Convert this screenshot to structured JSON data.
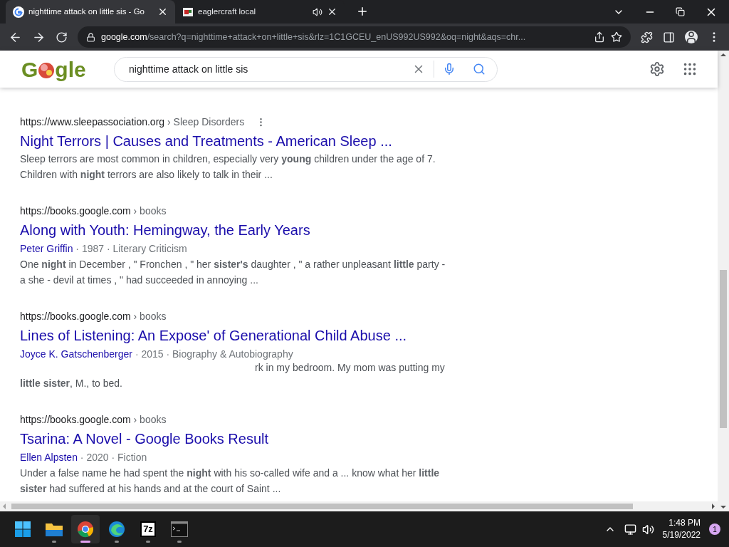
{
  "tabs": [
    {
      "title": "nighttime attack on little sis - Go",
      "selected": true,
      "kind": "google"
    },
    {
      "title": "eaglercraft local",
      "selected": false,
      "kind": "game",
      "audio": true
    }
  ],
  "address": {
    "host": "google.com",
    "path": "/search?q=nighttime+attack+on+little+sis&rlz=1C1GCEU_enUS992US992&oq=night&aqs=chr..."
  },
  "logo": {
    "left": "G",
    "right": "gle"
  },
  "search": {
    "value": "nighttime attack on little sis"
  },
  "results": [
    {
      "url": "https://www.sleepassociation.org",
      "crumb": "› Sleep Disorders",
      "menu": true,
      "title": "Night Terrors | Causes and Treatments - American Sleep ...",
      "snippet": "Sleep terrors are most common in children, especially very **young** children under the age of 7. Children with **night** terrors are also likely to talk in their ...",
      "overlap": false
    },
    {
      "url": "https://books.google.com",
      "crumb": "› books",
      "menu": false,
      "title": "Along with Youth: Hemingway, the Early Years",
      "author": "Peter Griffin",
      "meta": "· 1987 · Literary Criticism",
      "snippet": "One **night** in December , \" Fronchen , \" her **sister's** daughter , \" a rather unpleasant **little** party - a she - devil at times , \" had succeeded in annoying ...",
      "overlap": false
    },
    {
      "url": "https://books.google.com",
      "crumb": "› books",
      "menu": false,
      "title": "Lines of Listening: An Expose' of Generational Child Abuse ...",
      "author": "Joyce K. Gatschenberger",
      "meta": "· 2015 · Biography & Autobiography",
      "snippet": "rk in my bedroom. My mom was putting my **little sister**, M., to bed.",
      "overlap": true
    },
    {
      "url": "https://books.google.com",
      "crumb": "› books",
      "menu": false,
      "title": "Tsarina: A Novel - Google Books Result",
      "author": "Ellen Alpsten",
      "meta": "· 2020 · Fiction",
      "snippet": "Under a false name he had spent the **night** with his so-called wife and a ... know what her **little** **sister** had suffered at his hands and at the court of Saint ...",
      "overlap": false
    }
  ],
  "taskbar": {
    "apps": [
      {
        "kind": "start",
        "selected": false
      },
      {
        "kind": "folder",
        "selected": false
      },
      {
        "kind": "chrome",
        "selected": true
      },
      {
        "kind": "edge",
        "selected": false
      },
      {
        "kind": "zip",
        "label": "7z",
        "selected": false
      },
      {
        "kind": "terminal",
        "selected": false
      }
    ],
    "time": "1:48 PM",
    "date": "5/19/2022",
    "badge": "1"
  }
}
